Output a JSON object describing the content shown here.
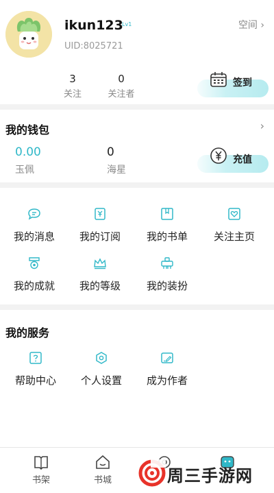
{
  "profile": {
    "username": "ikun123",
    "level": "Lv1",
    "uid": "UID:8025721",
    "space_link": "空间",
    "stats": [
      {
        "value": "3",
        "label": "关注"
      },
      {
        "value": "0",
        "label": "关注者"
      }
    ],
    "checkin_label": "签到"
  },
  "wallet": {
    "title": "我的钱包",
    "items": [
      {
        "value": "0.00",
        "label": "玉佩"
      },
      {
        "value": "0",
        "label": "海星"
      }
    ],
    "recharge_label": "充值"
  },
  "menu": [
    {
      "label": "我的消息",
      "icon": "message-icon"
    },
    {
      "label": "我的订阅",
      "icon": "subscription-icon"
    },
    {
      "label": "我的书单",
      "icon": "booklist-icon"
    },
    {
      "label": "关注主页",
      "icon": "follow-heart-icon"
    },
    {
      "label": "我的成就",
      "icon": "achievement-medal-icon"
    },
    {
      "label": "我的等级",
      "icon": "level-crown-icon"
    },
    {
      "label": "我的装扮",
      "icon": "dressup-icon"
    }
  ],
  "services": {
    "title": "我的服务",
    "items": [
      {
        "label": "帮助中心",
        "icon": "help-icon"
      },
      {
        "label": "个人设置",
        "icon": "settings-icon"
      },
      {
        "label": "成为作者",
        "icon": "become-author-icon"
      }
    ]
  },
  "tabbar": {
    "items": [
      {
        "label": "书架",
        "icon": "bookshelf-icon"
      },
      {
        "label": "书城",
        "icon": "bookstore-icon"
      },
      {
        "label": "",
        "icon": "at-icon"
      },
      {
        "label": "",
        "icon": "profile-tab-icon"
      }
    ]
  },
  "watermark": {
    "text": "周三手游网"
  },
  "colors": {
    "accent": "#30b8c8",
    "pill": "#c9f1f4",
    "background": "#f2f2f2"
  }
}
